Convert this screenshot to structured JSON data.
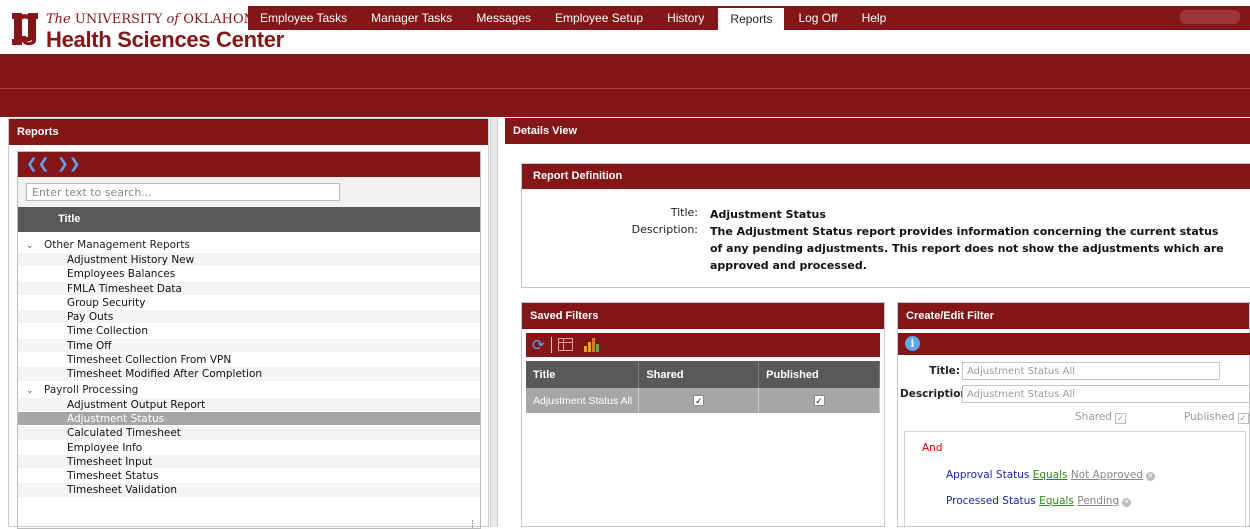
{
  "header": {
    "logo_line1_pre": "The",
    "logo_line1_main": "UNIVERSITY",
    "logo_line1_of": "of",
    "logo_line1_end": "OKLAHOMA",
    "logo_line2": "Health Sciences Center",
    "brand_color": "#841617"
  },
  "nav": {
    "items": [
      {
        "label": "Employee Tasks"
      },
      {
        "label": "Manager Tasks"
      },
      {
        "label": "Messages"
      },
      {
        "label": "Employee Setup"
      },
      {
        "label": "History"
      },
      {
        "label": "Reports",
        "active": true
      },
      {
        "label": "Log Off"
      },
      {
        "label": "Help"
      }
    ]
  },
  "reports_panel": {
    "title": "Reports",
    "search_placeholder": "Enter text to search...",
    "column_title": "Title",
    "groups": [
      {
        "label": "Other Management Reports",
        "items": [
          "Adjustment History New",
          "Employees Balances",
          "FMLA Timesheet Data",
          "Group Security",
          "Pay Outs",
          "Time Collection",
          "Time Off",
          "Timesheet Collection From VPN",
          "Timesheet Modified After Completion"
        ]
      },
      {
        "label": "Payroll Processing",
        "items": [
          "Adjustment Output Report",
          "Adjustment Status",
          "Calculated Timesheet",
          "Employee Info",
          "Timesheet Input",
          "Timesheet Status",
          "Timesheet Validation"
        ],
        "selected": "Adjustment Status"
      }
    ]
  },
  "details": {
    "title": "Details View",
    "definition": {
      "header": "Report Definition",
      "title_label": "Title:",
      "title_value": "Adjustment Status",
      "description_label": "Description:",
      "description_line1": "The Adjustment Status report provides information concerning the current status",
      "description_line2": "of any pending adjustments. This report does not show the adjustments which are",
      "description_line3": "approved and processed."
    },
    "saved_filters": {
      "header": "Saved Filters",
      "columns": [
        "Title",
        "Shared",
        "Published"
      ],
      "rows": [
        {
          "title": "Adjustment Status All",
          "shared": true,
          "published": true
        }
      ]
    },
    "edit_filter": {
      "header": "Create/Edit Filter",
      "title_label": "Title:",
      "title_value": "Adjustment Status All",
      "description_label": "Description:",
      "description_value": "Adjustment Status All",
      "shared_label": "Shared",
      "published_label": "Published",
      "logic": "And",
      "conditions": [
        {
          "field": "Approval Status",
          "op": "Equals",
          "value": "Not Approved"
        },
        {
          "field": "Processed Status",
          "op": "Equals",
          "value": "Pending"
        }
      ]
    }
  }
}
